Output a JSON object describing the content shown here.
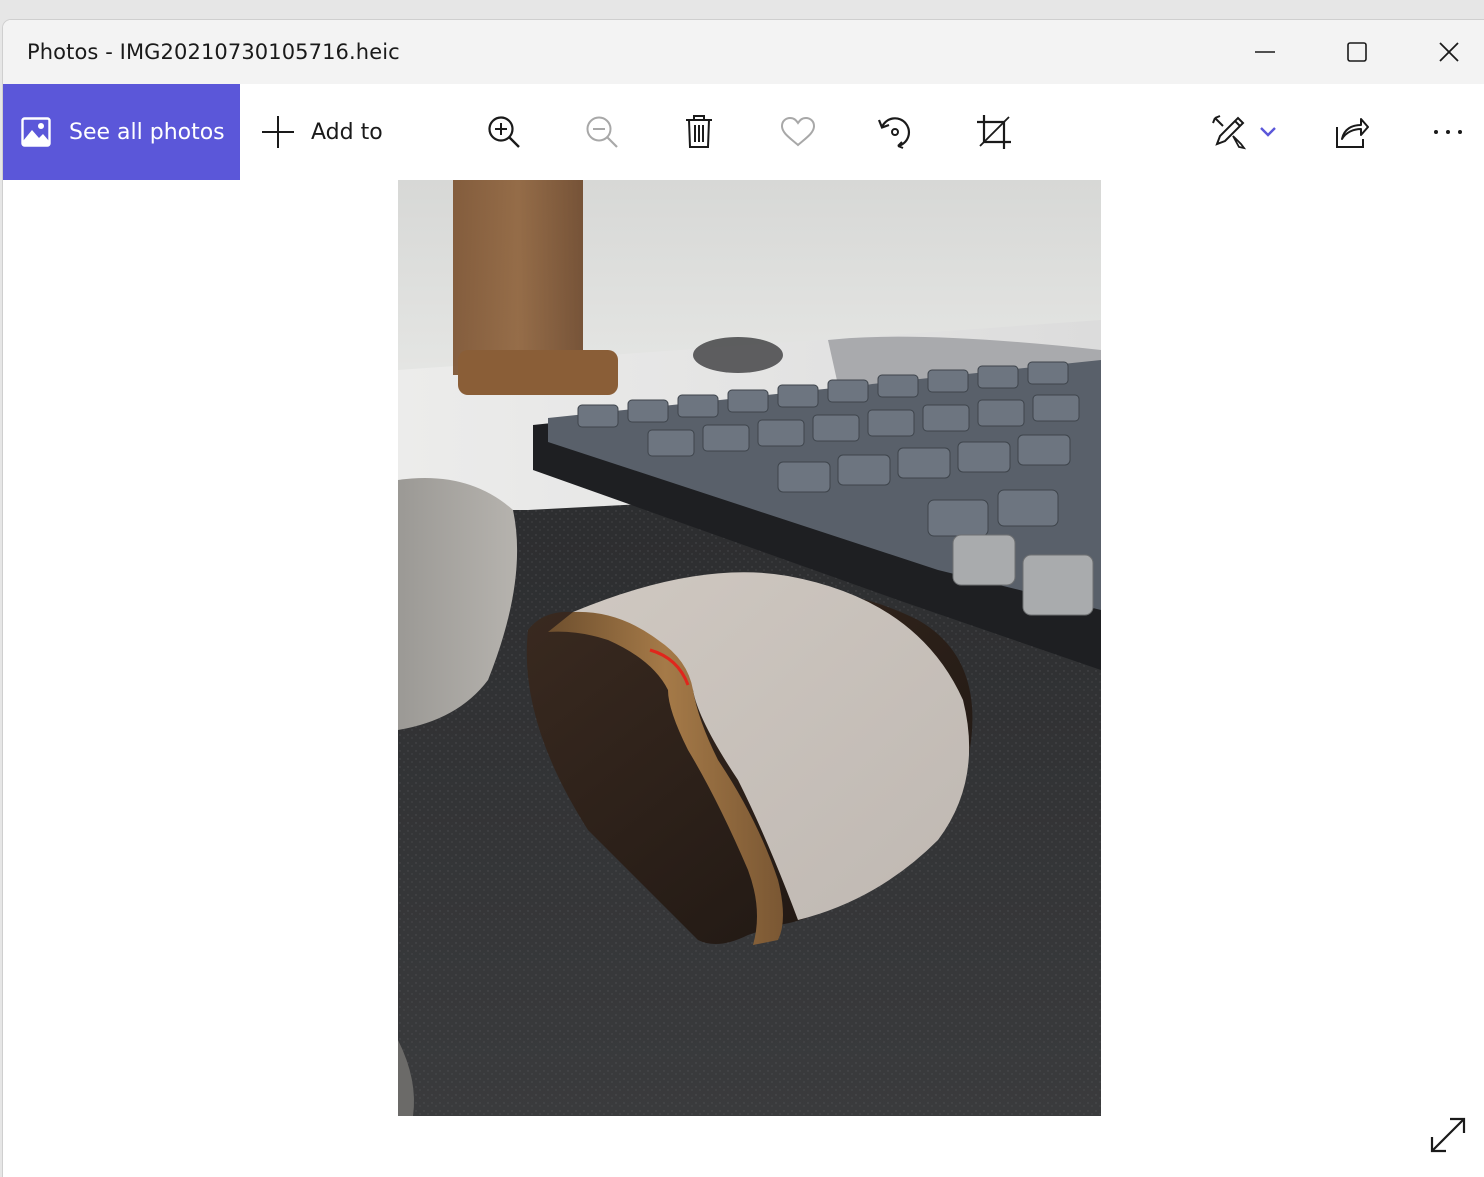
{
  "window": {
    "title": "Photos - IMG20210730105716.heic"
  },
  "toolbar": {
    "see_all_label": "See all photos",
    "add_to_label": "Add to",
    "accent_color": "#5b57d9"
  },
  "icons": {
    "image": "image-icon",
    "add": "plus-icon",
    "zoom_in": "zoom-in-icon",
    "zoom_out": "zoom-out-icon",
    "delete": "trash-icon",
    "favorite": "heart-icon",
    "rotate": "rotate-icon",
    "crop": "crop-icon",
    "edit": "edit-pencil-icon",
    "share": "share-icon",
    "more": "more-icon",
    "expand": "expand-icon"
  }
}
